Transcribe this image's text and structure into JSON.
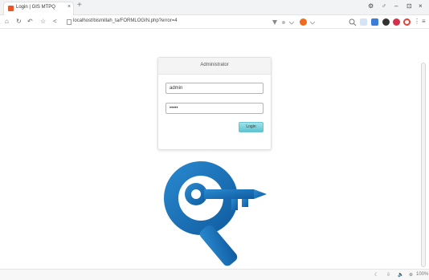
{
  "browser": {
    "tab": {
      "title": "Login | GIS MTPQ",
      "close": "×"
    },
    "new_tab": "+",
    "window_controls": {
      "settings": "⚙",
      "pin": "♂",
      "minimize": "–",
      "maximize": "⊡",
      "close": "×"
    },
    "nav": {
      "home": "⌂",
      "refresh": "↻",
      "back": "↶",
      "star": "☆",
      "prev": "<"
    },
    "url": "localhost/bismillah_ta/FORMLOGIN.php?error=4",
    "status": {
      "zoom": "100%",
      "zoom_icon": "⊕",
      "audio": "🔈",
      "down": "⇩"
    }
  },
  "login": {
    "title": "Administrator",
    "username": "admin",
    "password": "•••••",
    "button": "Login"
  },
  "colors": {
    "accent": "#5cc4d2",
    "logo_blue": "#1b6fb5"
  }
}
